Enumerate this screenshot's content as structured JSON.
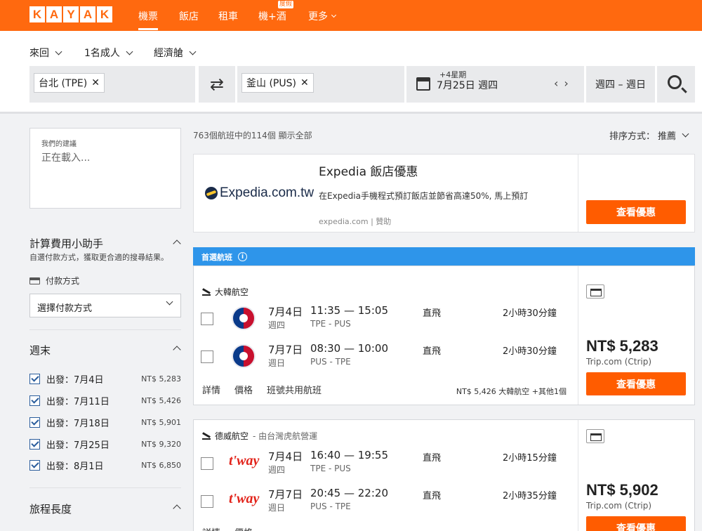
{
  "nav": {
    "logo_letters": [
      "K",
      "A",
      "Y",
      "A",
      "K"
    ],
    "items": [
      {
        "label": "機票",
        "active": true
      },
      {
        "label": "飯店"
      },
      {
        "label": "租車"
      },
      {
        "label": "機+酒"
      },
      {
        "label": "更多"
      }
    ],
    "holiday_badge": "度假",
    "accent": "#ff690f"
  },
  "search": {
    "trip_type": "來回",
    "passengers": "1名成人",
    "cabin": "經濟艙",
    "origin": "台北 (TPE)",
    "destination": "釜山 (PUS)",
    "plus_week": "+4星期",
    "date": "7月25日 週四",
    "weekday_range": "週四 – 週日"
  },
  "sidebar": {
    "rec_small": "我們的建議",
    "rec_loading": "正在載入...",
    "fee_title": "計算費用小助手",
    "fee_sub": "自選付款方式，獲取更合適的搜尋結果。",
    "pay_label": "付款方式",
    "pay_select": "選擇付款方式",
    "weekend_title": "週末",
    "weekends": [
      {
        "label": "出發：7月4日",
        "price": "NT$ 5,283"
      },
      {
        "label": "出發：7月11日",
        "price": "NT$ 5,426"
      },
      {
        "label": "出發：7月18日",
        "price": "NT$ 5,901"
      },
      {
        "label": "出發：7月25日",
        "price": "NT$ 9,320"
      },
      {
        "label": "出發：8月1日",
        "price": "NT$ 6,850"
      }
    ],
    "trip_length_title": "旅程長度"
  },
  "results": {
    "count_text": "763個航班中的114個 顯示全部",
    "sort_label": "排序方式：",
    "sort_value": "推薦"
  },
  "ad": {
    "logo_text": "Expedia.com.tw",
    "title": "Expedia 飯店優惠",
    "desc": "在Expedia手機程式預訂飯店並節省高達50%, 馬上預訂",
    "source": "expedia.com | 贊助",
    "cta": "查看優惠"
  },
  "banner": {
    "label": "首選航班",
    "info_glyph": "i",
    "color": "#2e95ea"
  },
  "flights": [
    {
      "airline": "大韓航空",
      "operator": "",
      "legs": [
        {
          "date": "7月4日",
          "dow": "週四",
          "times": "11:35 — 15:05",
          "airports": "TPE  -  PUS",
          "stops": "直飛",
          "duration": "2小時30分鐘"
        },
        {
          "date": "7月7日",
          "dow": "週日",
          "times": "08:30 — 10:00",
          "airports": "PUS  -  TPE",
          "stops": "直飛",
          "duration": "2小時30分鐘"
        }
      ],
      "links": [
        "詳情",
        "價格",
        "班號共用航班"
      ],
      "bottom_note": "NT$ 5,426 大韓航空   +其他1個",
      "price": "NT$ 5,283",
      "provider": "Trip.com (Ctrip)",
      "cta": "查看優惠"
    },
    {
      "airline": "德威航空",
      "operator": "- 由台灣虎航營運",
      "logo_text": "t'way",
      "legs": [
        {
          "date": "7月4日",
          "dow": "週四",
          "times": "16:40 — 19:55",
          "airports": "TPE  -  PUS",
          "stops": "直飛",
          "duration": "2小時15分鐘"
        },
        {
          "date": "7月7日",
          "dow": "週日",
          "times": "20:45 — 22:20",
          "airports": "PUS  -  TPE",
          "stops": "直飛",
          "duration": "2小時35分鐘"
        }
      ],
      "links": [
        "詳情",
        "價格"
      ],
      "price": "NT$ 5,902",
      "provider": "Trip.com (Ctrip)",
      "cta": "查看優惠"
    }
  ]
}
